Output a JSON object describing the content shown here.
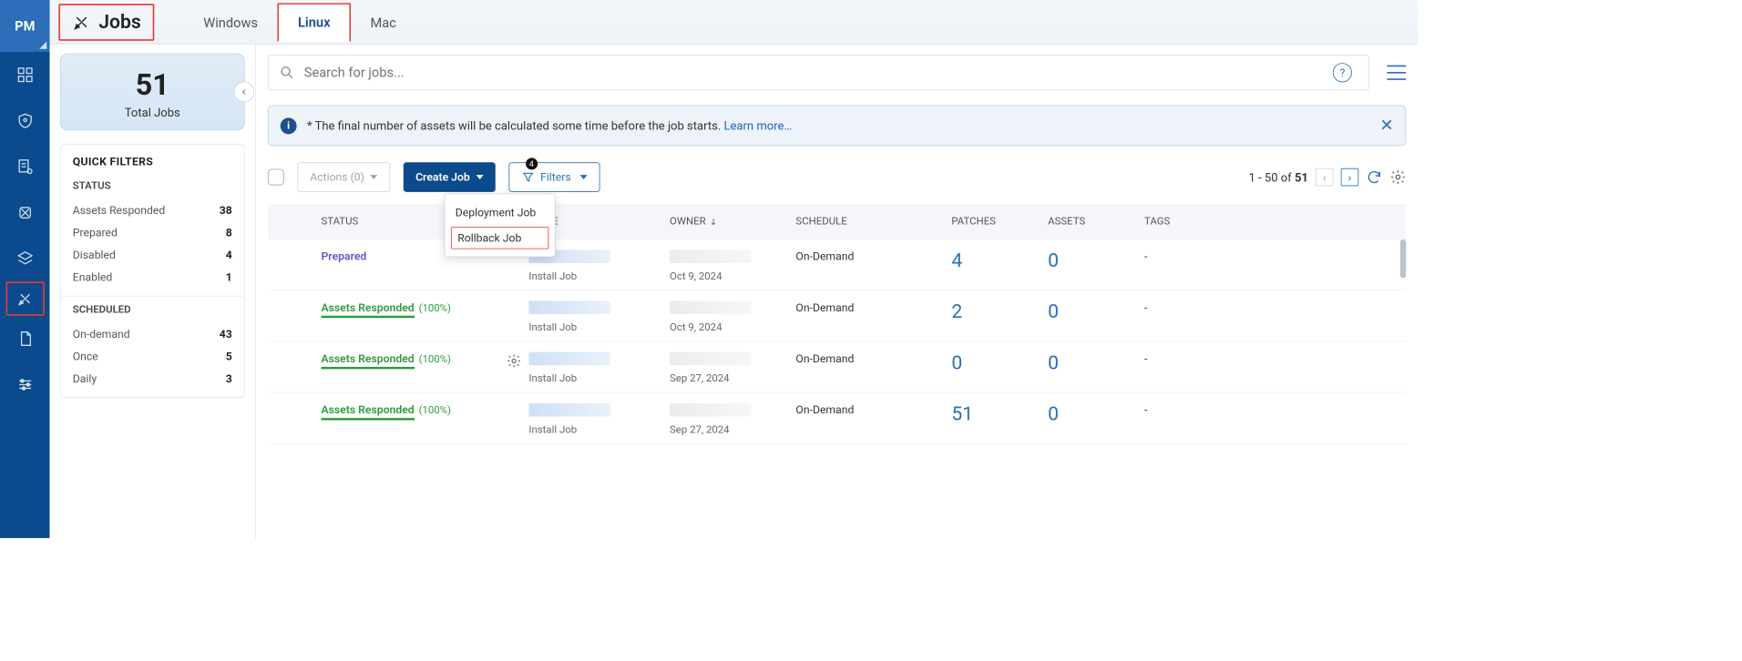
{
  "rail": {
    "label": "PM"
  },
  "title": "Jobs",
  "tabs": [
    {
      "label": "Windows",
      "active": false
    },
    {
      "label": "Linux",
      "active": true
    },
    {
      "label": "Mac",
      "active": false
    }
  ],
  "total": {
    "value": "51",
    "label": "Total Jobs"
  },
  "quick_filters": {
    "heading": "QUICK FILTERS",
    "status_label": "STATUS",
    "status": [
      {
        "label": "Assets Responded",
        "count": "38"
      },
      {
        "label": "Prepared",
        "count": "8"
      },
      {
        "label": "Disabled",
        "count": "4"
      },
      {
        "label": "Enabled",
        "count": "1"
      }
    ],
    "scheduled_label": "SCHEDULED",
    "scheduled": [
      {
        "label": "On-demand",
        "count": "43"
      },
      {
        "label": "Once",
        "count": "5"
      },
      {
        "label": "Daily",
        "count": "3"
      }
    ]
  },
  "search": {
    "placeholder": "Search for jobs..."
  },
  "help_glyph": "?",
  "info": {
    "prefix": "* The final number of assets will be calculated some time before the job starts. ",
    "link": "Learn more…"
  },
  "toolbar": {
    "actions": "Actions (0)",
    "create": "Create Job",
    "filters": "Filters",
    "filter_badge": "4",
    "dropdown": {
      "opt1": "Deployment Job",
      "opt2": "Rollback Job"
    }
  },
  "pager": {
    "range_prefix": "1 - 50 of ",
    "total": "51"
  },
  "columns": {
    "status": "STATUS",
    "name": "NAME",
    "owner": "OWNER",
    "schedule": "SCHEDULE",
    "patches": "PATCHES",
    "assets": "ASSETS",
    "tags": "TAGS"
  },
  "rows": [
    {
      "status": "Prepared",
      "status_kind": "prepared",
      "pct": "",
      "name_sub": "Install Job",
      "owner_sub": "Oct 9, 2024",
      "schedule": "On-Demand",
      "patches": "4",
      "assets": "0",
      "tags": "-",
      "gear": false
    },
    {
      "status": "Assets Responded",
      "status_kind": "resp",
      "pct": "(100%)",
      "name_sub": "Install Job",
      "owner_sub": "Oct 9, 2024",
      "schedule": "On-Demand",
      "patches": "2",
      "assets": "0",
      "tags": "-",
      "gear": false
    },
    {
      "status": "Assets Responded",
      "status_kind": "resp",
      "pct": "(100%)",
      "name_sub": "Install Job",
      "owner_sub": "Sep 27, 2024",
      "schedule": "On-Demand",
      "patches": "0",
      "assets": "0",
      "tags": "-",
      "gear": true
    },
    {
      "status": "Assets Responded",
      "status_kind": "resp",
      "pct": "(100%)",
      "name_sub": "Install Job",
      "owner_sub": "Sep 27, 2024",
      "schedule": "On-Demand",
      "patches": "51",
      "assets": "0",
      "tags": "-",
      "gear": false
    }
  ]
}
